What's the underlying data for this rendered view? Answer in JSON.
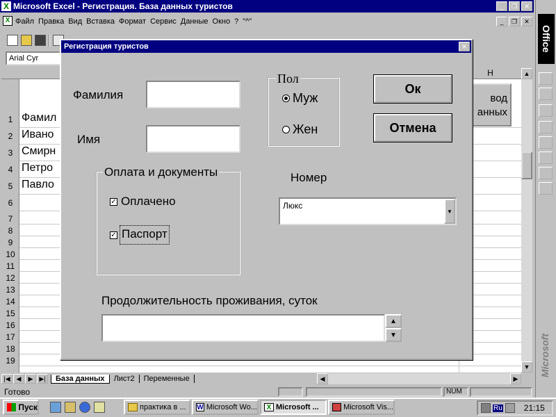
{
  "app": {
    "title": "Microsoft Excel - Регистрация. База данных туристов",
    "menu": [
      "Файл",
      "Правка",
      "Вид",
      "Вставка",
      "Формат",
      "Сервис",
      "Данные",
      "Окно",
      "?",
      "\"^\""
    ],
    "font_name": "Arial Cyr"
  },
  "sheet": {
    "rows": [
      "1",
      "2",
      "3",
      "4",
      "5",
      "6",
      "7",
      "8",
      "9",
      "10",
      "11",
      "12",
      "13",
      "14",
      "15",
      "16",
      "17",
      "18",
      "19"
    ],
    "col_header_visible": "Н",
    "cells": [
      "Фамил",
      "Ивано",
      "Смирн",
      "Петро",
      "Павло"
    ],
    "button_label_line1": "вод",
    "button_label_line2": "анных",
    "tabs": [
      "База данных",
      "Лист2",
      "Переменные"
    ]
  },
  "statusbar": {
    "ready": "Готово",
    "num": "NUM"
  },
  "dialog": {
    "title": "Регистрация туристов",
    "surname_label": "Фамилия",
    "surname_value": "",
    "name_label": "Имя",
    "name_value": "",
    "gender_group": "Пол",
    "gender_male": "Муж",
    "gender_female": "Жен",
    "ok": "Ок",
    "cancel": "Отмена",
    "payment_group": "Оплата и документы",
    "paid": "Оплачено",
    "passport": "Паспорт",
    "room_label": "Номер",
    "room_value": "Люкс",
    "duration_label": "Продолжительность проживания, суток",
    "duration_value": ""
  },
  "office_bar": {
    "logo": "Office",
    "brand": "Microsoft"
  },
  "taskbar": {
    "start": "Пуск",
    "buttons": [
      "практика в ...",
      "Microsoft Wo...",
      "Microsoft ...",
      "Microsoft Vis..."
    ],
    "lang": "Ru",
    "clock": "21:15"
  }
}
